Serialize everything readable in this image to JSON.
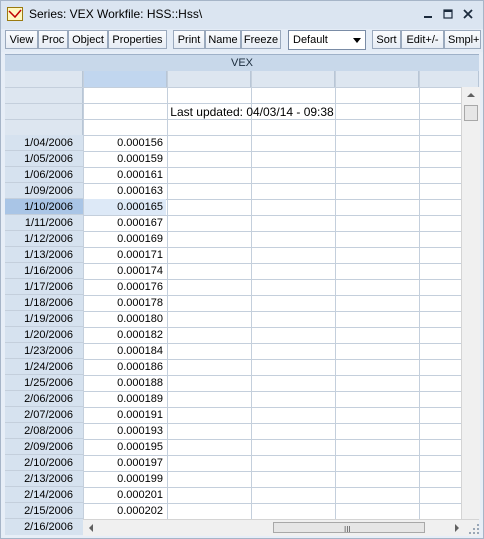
{
  "window": {
    "title": "Series: VEX   Workfile: HSS::Hss\\",
    "minimize_icon": "minimize-icon",
    "maximize_icon": "maximize-icon",
    "close_icon": "close-icon"
  },
  "toolbar": {
    "view": "View",
    "proc": "Proc",
    "object": "Object",
    "properties": "Properties",
    "print": "Print",
    "name": "Name",
    "freeze": "Freeze",
    "display_select": "Default",
    "sort": "Sort",
    "edit": "Edit+/-",
    "smpl": "Smpl+"
  },
  "spreadsheet": {
    "series_name": "VEX",
    "last_updated": "Last updated: 04/03/14 - 09:38",
    "selected_row": "1/10/2006",
    "rows": [
      {
        "date": "1/04/2006",
        "value": "0.000156"
      },
      {
        "date": "1/05/2006",
        "value": "0.000159"
      },
      {
        "date": "1/06/2006",
        "value": "0.000161"
      },
      {
        "date": "1/09/2006",
        "value": "0.000163"
      },
      {
        "date": "1/10/2006",
        "value": "0.000165"
      },
      {
        "date": "1/11/2006",
        "value": "0.000167"
      },
      {
        "date": "1/12/2006",
        "value": "0.000169"
      },
      {
        "date": "1/13/2006",
        "value": "0.000171"
      },
      {
        "date": "1/16/2006",
        "value": "0.000174"
      },
      {
        "date": "1/17/2006",
        "value": "0.000176"
      },
      {
        "date": "1/18/2006",
        "value": "0.000178"
      },
      {
        "date": "1/19/2006",
        "value": "0.000180"
      },
      {
        "date": "1/20/2006",
        "value": "0.000182"
      },
      {
        "date": "1/23/2006",
        "value": "0.000184"
      },
      {
        "date": "1/24/2006",
        "value": "0.000186"
      },
      {
        "date": "1/25/2006",
        "value": "0.000188"
      },
      {
        "date": "2/06/2006",
        "value": "0.000189"
      },
      {
        "date": "2/07/2006",
        "value": "0.000191"
      },
      {
        "date": "2/08/2006",
        "value": "0.000193"
      },
      {
        "date": "2/09/2006",
        "value": "0.000195"
      },
      {
        "date": "2/10/2006",
        "value": "0.000197"
      },
      {
        "date": "2/13/2006",
        "value": "0.000199"
      },
      {
        "date": "2/14/2006",
        "value": "0.000201"
      },
      {
        "date": "2/15/2006",
        "value": "0.000202"
      }
    ],
    "partial_last_date": "2/16/2006"
  },
  "scrollbar": {
    "grip": "III"
  }
}
